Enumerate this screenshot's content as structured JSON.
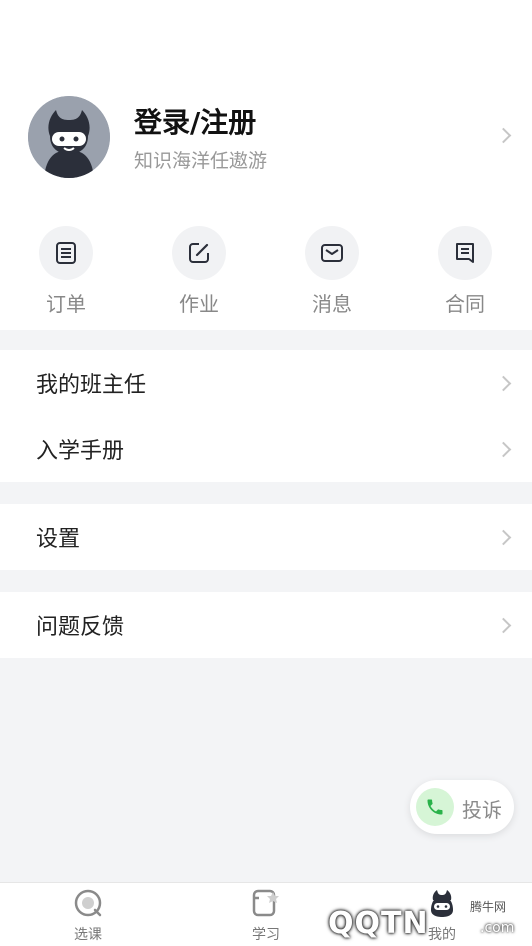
{
  "profile": {
    "title": "登录/注册",
    "subtitle": "知识海洋任遨游"
  },
  "quick_actions": [
    {
      "label": "订单",
      "icon": "order-icon"
    },
    {
      "label": "作业",
      "icon": "homework-icon"
    },
    {
      "label": "消息",
      "icon": "message-icon"
    },
    {
      "label": "合同",
      "icon": "contract-icon"
    }
  ],
  "menu": {
    "group1": [
      {
        "label": "我的班主任"
      },
      {
        "label": "入学手册"
      }
    ],
    "group2": [
      {
        "label": "设置"
      }
    ],
    "group3": [
      {
        "label": "问题反馈"
      }
    ]
  },
  "complaint": {
    "label": "投诉",
    "icon": "phone-icon"
  },
  "tabbar": {
    "tabs": [
      {
        "label": "选课",
        "icon": "course-select-icon"
      },
      {
        "label": "学习",
        "icon": "study-icon"
      },
      {
        "label": "我的",
        "icon": "mine-icon"
      }
    ]
  },
  "watermark": {
    "site_name": "腾牛网",
    "logo_text": "QQTN",
    "domain_suffix": ".com"
  },
  "colors": {
    "background": "#f3f4f6",
    "accent_green": "#2ab24a",
    "icon_dark": "#2b2f3a"
  }
}
